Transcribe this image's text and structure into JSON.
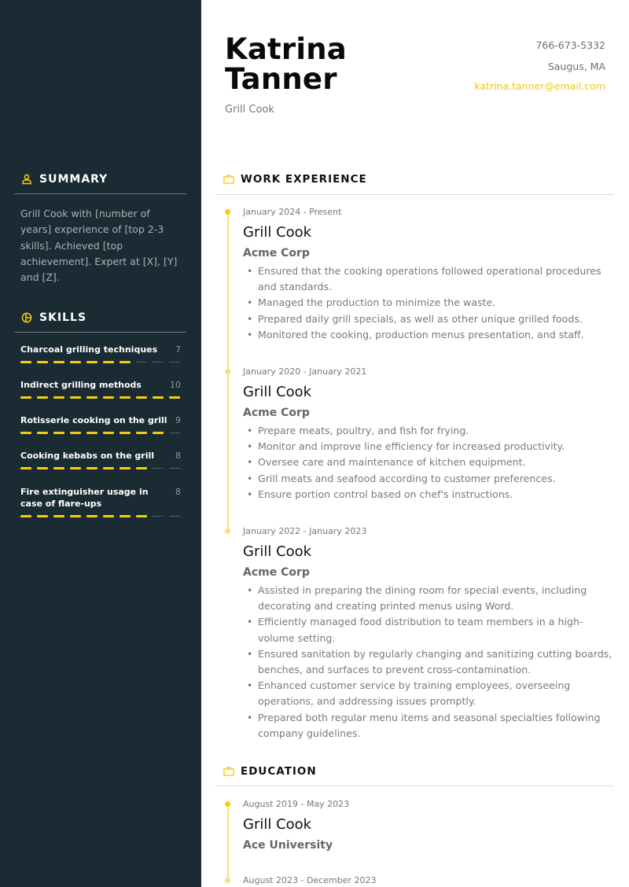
{
  "colors": {
    "sidebar_bg": "#1b2b33",
    "accent": "#f5cf0f",
    "accent_soft": "#f8e07b"
  },
  "header": {
    "first_name": "Katrina",
    "last_name": "Tanner",
    "role": "Grill Cook",
    "phone": "766-673-5332",
    "location": "Saugus, MA",
    "email": "katrina.tanner@email.com"
  },
  "sidebar": {
    "summary": {
      "title": "SUMMARY",
      "icon": "user-icon",
      "text": "Grill Cook with [number of years] experience of [top 2-3 skills]. Achieved [top achievement]. Expert at [X], [Y] and [Z]."
    },
    "skills": {
      "title": "SKILLS",
      "icon": "pie-chart-icon",
      "max": 10,
      "items": [
        {
          "name": "Charcoal grilling techniques",
          "value": 7
        },
        {
          "name": "Indirect grilling methods",
          "value": 10
        },
        {
          "name": "Rotisserie cooking on the grill",
          "value": 9
        },
        {
          "name": "Cooking kebabs on the grill",
          "value": 8
        },
        {
          "name": "Fire extinguisher usage in case of flare-ups",
          "value": 8
        }
      ]
    }
  },
  "work": {
    "title": "WORK EXPERIENCE",
    "icon": "briefcase-icon",
    "entries": [
      {
        "date": "January 2024 - Present",
        "title": "Grill Cook",
        "org": "Acme Corp",
        "bullets": [
          "Ensured that the cooking operations followed operational procedures and standards.",
          "Managed the production to minimize the waste.",
          "Prepared daily grill specials, as well as other unique grilled foods.",
          "Monitored the cooking, production menus presentation, and staff."
        ]
      },
      {
        "date": "January 2020 - January 2021",
        "title": "Grill Cook",
        "org": "Acme Corp",
        "bullets": [
          "Prepare meats, poultry, and fish for frying.",
          "Monitor and improve line efficiency for increased productivity.",
          "Oversee care and maintenance of kitchen equipment.",
          "Grill meats and seafood according to customer preferences.",
          "Ensure portion control based on chef's instructions."
        ]
      },
      {
        "date": "January 2022 - January 2023",
        "title": "Grill Cook",
        "org": "Acme Corp",
        "bullets": [
          "Assisted in preparing the dining room for special events, including decorating and creating printed menus using Word.",
          "Efficiently managed food distribution to team members in a high-volume setting.",
          "Ensured sanitation by regularly changing and sanitizing cutting boards, benches, and surfaces to prevent cross-contamination.",
          "Enhanced customer service by training employees, overseeing operations, and addressing issues promptly.",
          "Prepared both regular menu items and seasonal specialties following company guidelines."
        ]
      }
    ]
  },
  "education": {
    "title": "EDUCATION",
    "icon": "briefcase-icon",
    "entries": [
      {
        "date": "August 2019 - May 2023",
        "title": "Grill Cook",
        "org": "Ace University"
      },
      {
        "date": "August 2023 - December 2023"
      }
    ]
  }
}
